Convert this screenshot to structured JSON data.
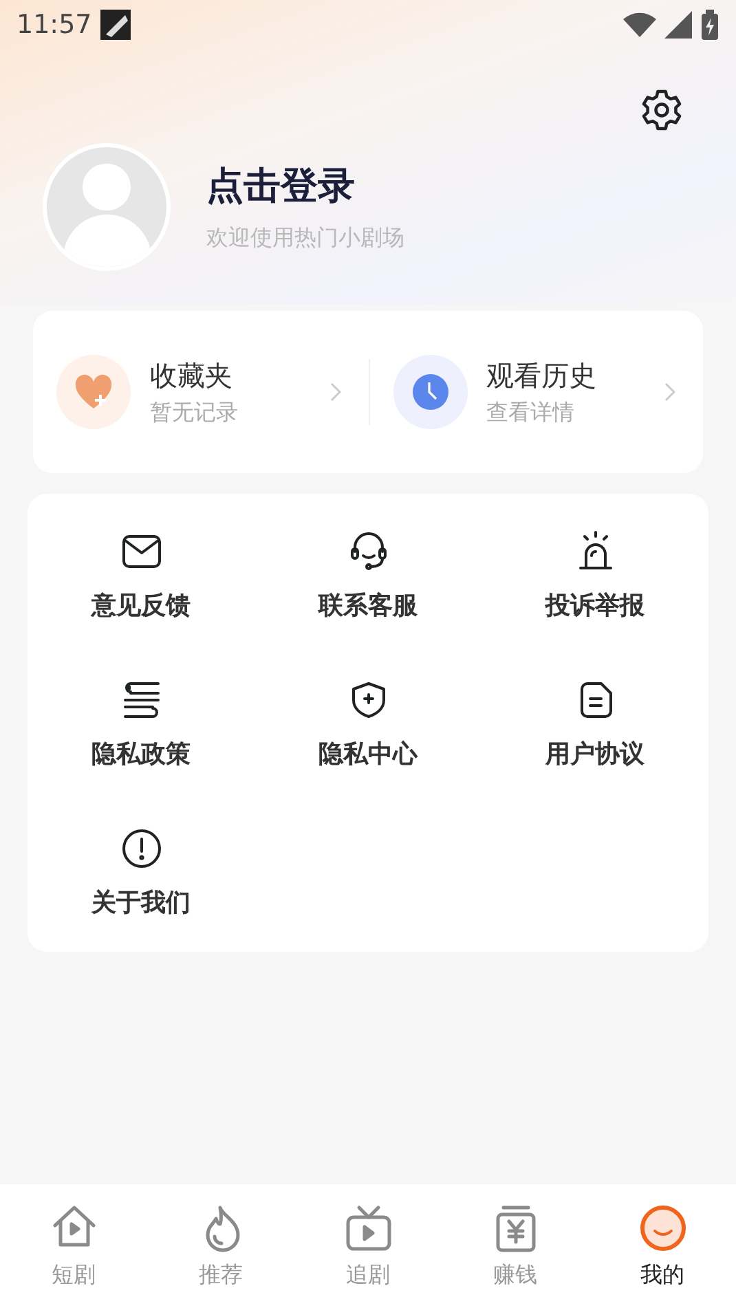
{
  "status_bar": {
    "time": "11:57"
  },
  "profile": {
    "name": "点击登录",
    "subtitle": "欢迎使用热门小剧场"
  },
  "quick_links": [
    {
      "kind": "favorites",
      "title": "收藏夹",
      "subtitle": "暂无记录"
    },
    {
      "kind": "history",
      "title": "观看历史",
      "subtitle": "查看详情"
    }
  ],
  "menu_items": [
    {
      "kind": "mail",
      "label": "意见反馈"
    },
    {
      "kind": "headset",
      "label": "联系客服"
    },
    {
      "kind": "alarm",
      "label": "投诉举报"
    },
    {
      "kind": "book",
      "label": "隐私政策"
    },
    {
      "kind": "shield",
      "label": "隐私中心"
    },
    {
      "kind": "document",
      "label": "用户协议"
    },
    {
      "kind": "info",
      "label": "关于我们"
    }
  ],
  "tab_bar": [
    {
      "kind": "home",
      "label": "短剧",
      "selected": false
    },
    {
      "kind": "fire",
      "label": "推荐",
      "selected": false
    },
    {
      "kind": "tv",
      "label": "追剧",
      "selected": false
    },
    {
      "kind": "money",
      "label": "赚钱",
      "selected": false
    },
    {
      "kind": "me",
      "label": "我的",
      "selected": true
    }
  ]
}
